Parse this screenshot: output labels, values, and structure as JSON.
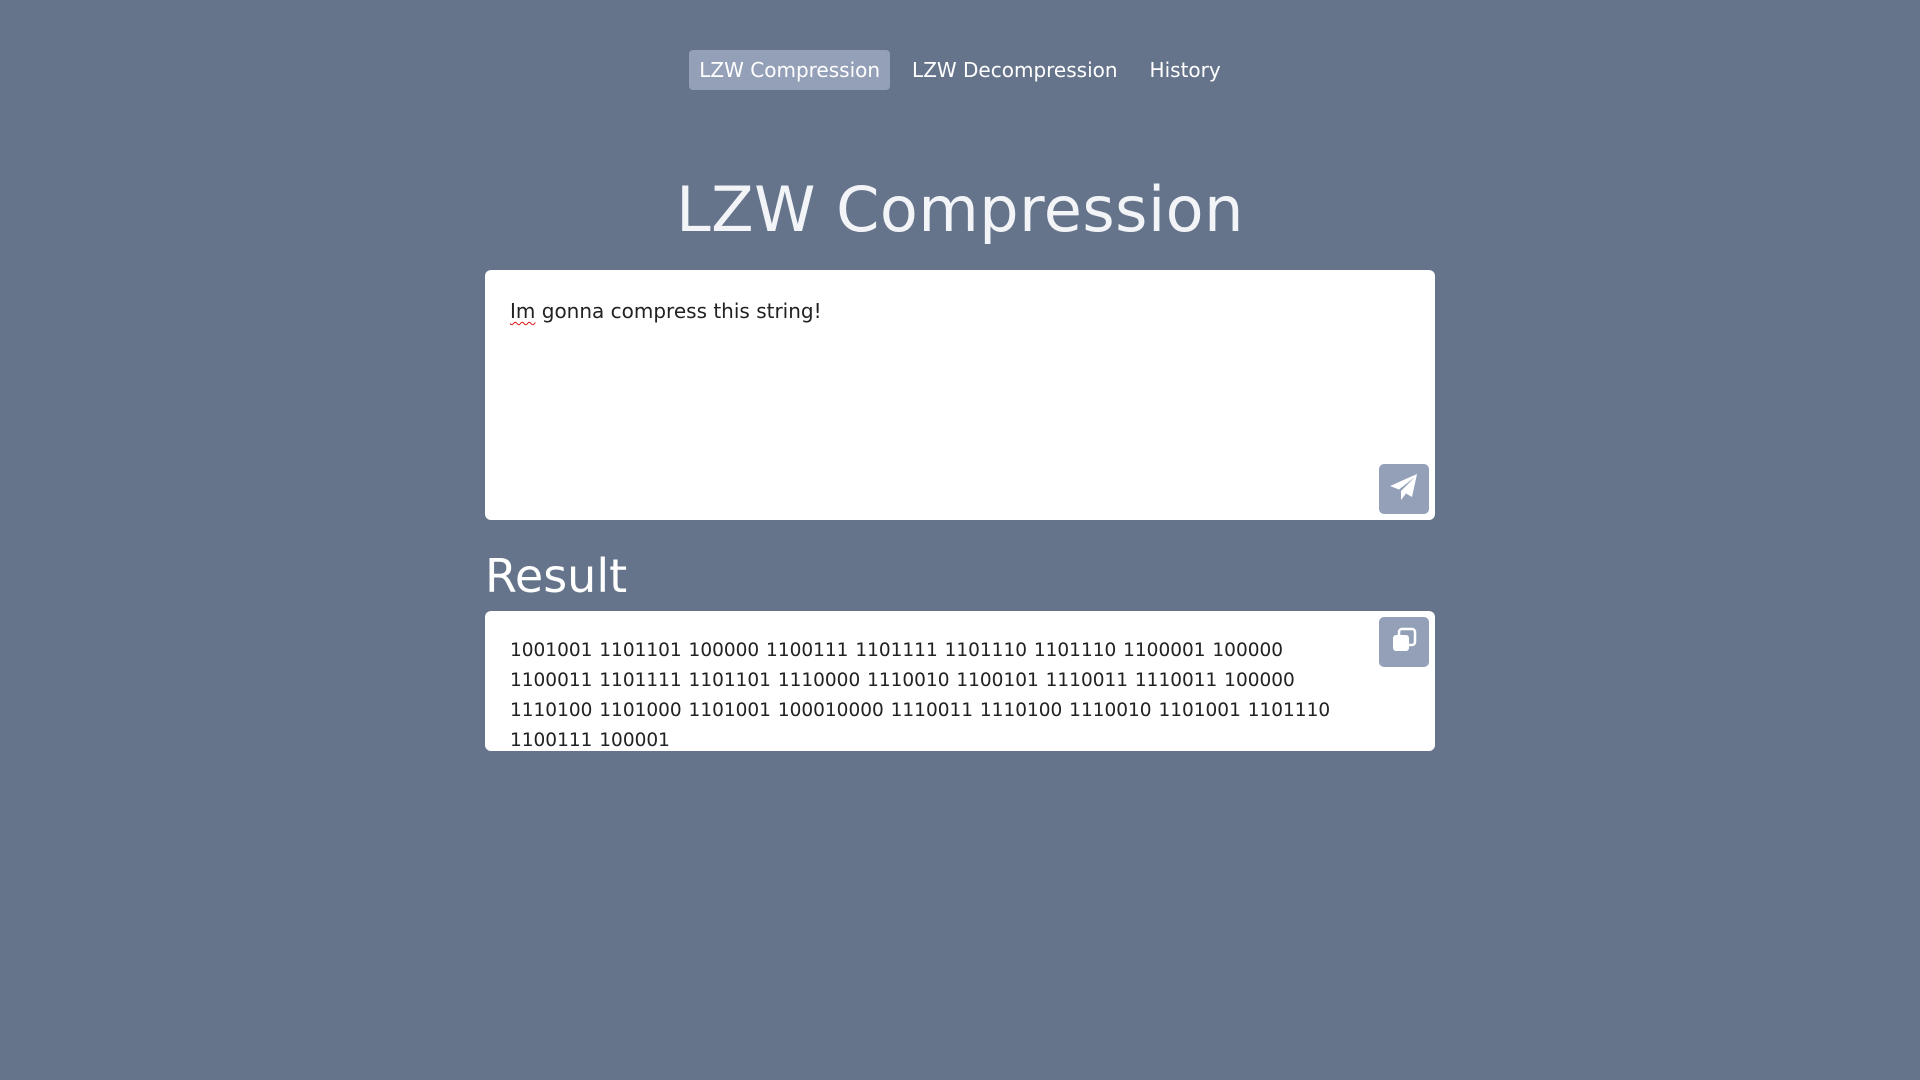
{
  "nav": {
    "items": [
      {
        "label": "LZW Compression",
        "active": true
      },
      {
        "label": "LZW Decompression",
        "active": false
      },
      {
        "label": "History",
        "active": false
      }
    ]
  },
  "page": {
    "title": "LZW Compression"
  },
  "input": {
    "first_word": "Im",
    "rest": " gonna compress this string!",
    "send_icon": "paper-plane-icon"
  },
  "result": {
    "heading": "Result",
    "value": "1001001 1101101 100000 1100111 1101111 1101110 1101110 1100001 100000 1100011 1101111 1101101 1110000 1110010 1100101 1110011 1110011 100000 1110100 1101000 1101001 100010000 1110011 1110100 1110010 1101001 1101110 1100111 100001",
    "copy_icon": "copy-icon"
  },
  "colors": {
    "background": "#65748b",
    "accent": "#94a0b7",
    "card": "#ffffff",
    "text": "#222222"
  }
}
